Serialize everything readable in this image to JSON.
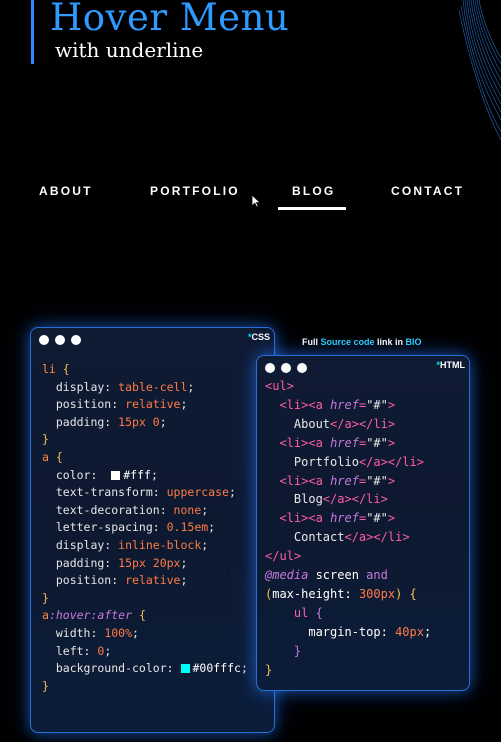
{
  "header": {
    "title": "Hover Menu",
    "subtitle": "with underline",
    "accent_color": "#2b8cff"
  },
  "nav": {
    "items": [
      "ABOUT",
      "PORTFOLIO",
      "BLOG",
      "CONTACT"
    ],
    "active": "BLOG",
    "underline_color": "#ffffff"
  },
  "css_panel": {
    "tag_star": "*",
    "tag": "CSS",
    "lines": [
      "li {",
      "  display: table-cell;",
      "  position: relative;",
      "  padding: 15px 0;",
      "}",
      "a {",
      "  color:  #fff;",
      "  text-transform: uppercase;",
      "  text-decoration: none;",
      "  letter-spacing: 0.15em;",
      "  display: inline-block;",
      "  padding: 15px 20px;",
      "  position: relative;",
      "}",
      "a:hover:after {",
      "  width: 100%;",
      "  left: 0;",
      "  background-color: #00fffc;",
      "}"
    ],
    "swatch_colors": [
      "#ffffff",
      "#00fffc"
    ]
  },
  "html_panel": {
    "tag_star": "*",
    "tag": "HTML",
    "lines": [
      "<ul>",
      "  <li><a href=\"#\">",
      "    About</a></li>",
      "  <li><a href=\"#\">",
      "    Portfolio</a></li>",
      "  <li><a href=\"#\">",
      "    Blog</a></li>",
      "  <li><a href=\"#\">",
      "    Contact</a></li>",
      "</ul>",
      "@media screen and",
      "(max-height: 300px) {",
      "    ul {",
      "      margin-top: 40px;",
      "    }",
      "}"
    ]
  },
  "source_note": {
    "prefix": "Full ",
    "highlight1": "Source code",
    "middle": " link in ",
    "highlight2": "BIO"
  }
}
